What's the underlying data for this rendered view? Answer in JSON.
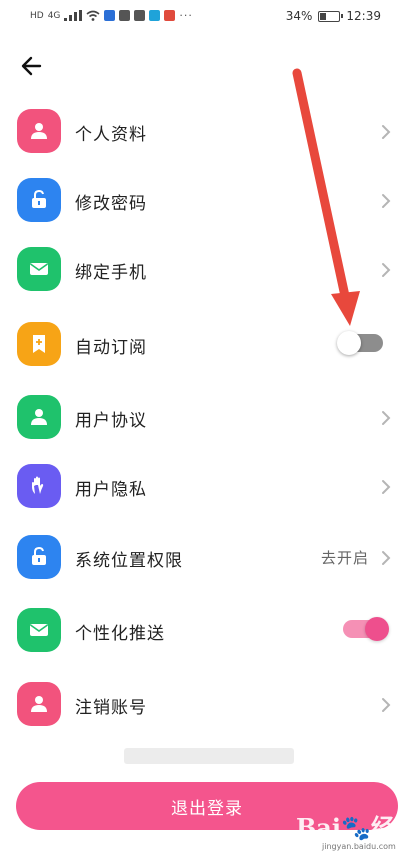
{
  "status_bar": {
    "left_text": "HD",
    "signal_text": "4G",
    "dots": "···",
    "battery_percent": "34%",
    "battery_level": 0.34,
    "time": "12:39"
  },
  "settings": {
    "items": [
      {
        "label": "个人资料",
        "icon": "user-icon",
        "color": "#f2537d",
        "control": "chevron"
      },
      {
        "label": "修改密码",
        "icon": "lock-icon",
        "color": "#2d84f0",
        "control": "chevron"
      },
      {
        "label": "绑定手机",
        "icon": "envelope-icon",
        "color": "#1fc26c",
        "control": "chevron"
      },
      {
        "label": "自动订阅",
        "icon": "bookmark-icon",
        "color": "#f7a416",
        "control": "switch",
        "enabled": false
      },
      {
        "label": "用户协议",
        "icon": "user-icon",
        "color": "#1fc26c",
        "control": "chevron"
      },
      {
        "label": "用户隐私",
        "icon": "hand-icon",
        "color": "#6a5cf2",
        "control": "chevron"
      },
      {
        "label": "系统位置权限",
        "icon": "lock-icon",
        "color": "#2d84f0",
        "control": "chevron",
        "value": "去开启"
      },
      {
        "label": "个性化推送",
        "icon": "envelope-icon",
        "color": "#1fc26c",
        "control": "switch",
        "enabled": true
      },
      {
        "label": "注销账号",
        "icon": "user-icon",
        "color": "#f2537d",
        "control": "chevron"
      }
    ]
  },
  "logout_label": "退出登录",
  "annotation_arrow_color": "#e8483c",
  "watermark": {
    "logo": "Bai 经验",
    "sub": "jingyan.baidu.com"
  }
}
